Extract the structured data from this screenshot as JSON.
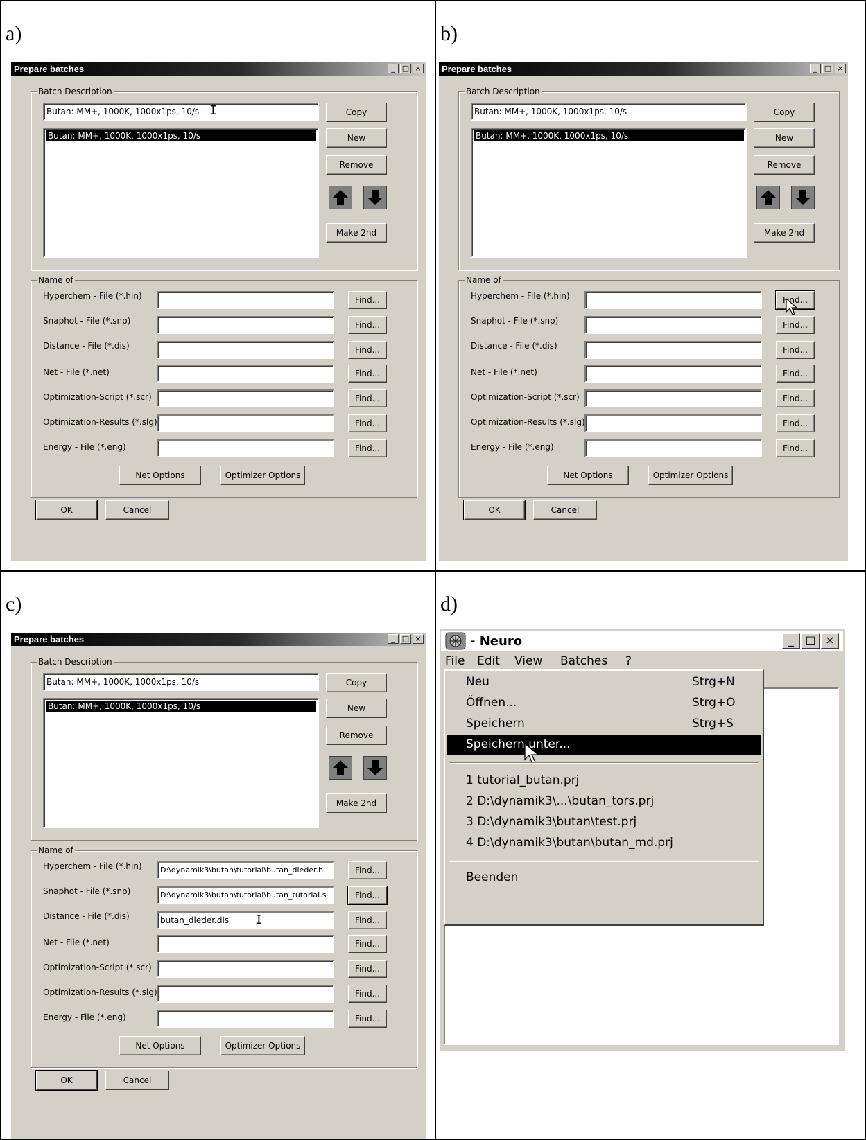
{
  "panels": {
    "a": {
      "label": "a)",
      "dialog": {
        "title": "Prepare batches",
        "batch_group": "Batch Description",
        "description_value": "Butan: MM+, 1000K, 1000x1ps, 10/s",
        "list_selected": "Butan: MM+, 1000K, 1000x1ps, 10/s",
        "buttons": {
          "copy": "Copy",
          "new": "New",
          "remove": "Remove",
          "make2nd": "Make 2nd"
        },
        "name_group": "Name of",
        "files": [
          {
            "label": "Hyperchem - File (*.hin)",
            "value": "",
            "find": "Find..."
          },
          {
            "label": "Snaphot - File (*.snp)",
            "value": "",
            "find": "Find..."
          },
          {
            "label": "Distance - File (*.dis)",
            "value": "",
            "find": "Find..."
          },
          {
            "label": "Net - File (*.net)",
            "value": "",
            "find": "Find..."
          },
          {
            "label": "Optimization-Script (*.scr)",
            "value": "",
            "find": "Find..."
          },
          {
            "label": "Optimization-Results (*.slg)",
            "value": "",
            "find": "Find..."
          },
          {
            "label": "Energy - File (*.eng)",
            "value": "",
            "find": "Find..."
          }
        ],
        "net_options": "Net Options",
        "optimizer_options": "Optimizer Options",
        "ok": "OK",
        "cancel": "Cancel"
      }
    },
    "b": {
      "label": "b)",
      "dialog": {
        "title": "Prepare batches",
        "batch_group": "Batch Description",
        "description_value": "Butan: MM+, 1000K, 1000x1ps, 10/s",
        "list_selected": "Butan: MM+, 1000K, 1000x1ps, 10/s",
        "buttons": {
          "copy": "Copy",
          "new": "New",
          "remove": "Remove",
          "make2nd": "Make 2nd"
        },
        "name_group": "Name of",
        "files": [
          {
            "label": "Hyperchem - File (*.hin)",
            "value": "",
            "find": "Find..."
          },
          {
            "label": "Snaphot - File (*.snp)",
            "value": "",
            "find": "Find..."
          },
          {
            "label": "Distance - File (*.dis)",
            "value": "",
            "find": "Find..."
          },
          {
            "label": "Net - File (*.net)",
            "value": "",
            "find": "Find..."
          },
          {
            "label": "Optimization-Script (*.scr)",
            "value": "",
            "find": "Find..."
          },
          {
            "label": "Optimization-Results (*.slg)",
            "value": "",
            "find": "Find..."
          },
          {
            "label": "Energy - File (*.eng)",
            "value": "",
            "find": "Find..."
          }
        ],
        "net_options": "Net Options",
        "optimizer_options": "Optimizer Options",
        "ok": "OK",
        "cancel": "Cancel"
      }
    },
    "c": {
      "label": "c)",
      "dialog": {
        "title": "Prepare batches",
        "batch_group": "Batch Description",
        "description_value": "Butan: MM+, 1000K, 1000x1ps, 10/s",
        "list_selected": "Butan: MM+, 1000K, 1000x1ps, 10/s",
        "buttons": {
          "copy": "Copy",
          "new": "New",
          "remove": "Remove",
          "make2nd": "Make 2nd"
        },
        "name_group": "Name of",
        "files": [
          {
            "label": "Hyperchem - File (*.hin)",
            "value": "D:\\dynamik3\\butan\\tutorial\\butan_dieder.h",
            "find": "Find..."
          },
          {
            "label": "Snaphot - File (*.snp)",
            "value": "D:\\dynamik3\\butan\\tutorial\\butan_tutorial.s",
            "find": "Find..."
          },
          {
            "label": "Distance - File (*.dis)",
            "value": "butan_dieder.dis",
            "find": "Find..."
          },
          {
            "label": "Net - File (*.net)",
            "value": "",
            "find": "Find..."
          },
          {
            "label": "Optimization-Script (*.scr)",
            "value": "",
            "find": "Find..."
          },
          {
            "label": "Optimization-Results (*.slg)",
            "value": "",
            "find": "Find..."
          },
          {
            "label": "Energy - File (*.eng)",
            "value": "",
            "find": "Find..."
          }
        ],
        "net_options": "Net Options",
        "optimizer_options": "Optimizer Options",
        "ok": "OK",
        "cancel": "Cancel"
      }
    },
    "d": {
      "label": "d)",
      "window": {
        "title": "- Neuro",
        "menus": [
          "File",
          "Edit",
          "View",
          "Batches",
          "?"
        ],
        "file_menu": {
          "items": [
            {
              "label": "Neu",
              "shortcut": "Strg+N"
            },
            {
              "label": "Öffnen...",
              "shortcut": "Strg+O"
            },
            {
              "label": "Speichern",
              "shortcut": "Strg+S"
            },
            {
              "label": "Speichern unter...",
              "shortcut": ""
            }
          ],
          "recent": [
            "1 tutorial_butan.prj",
            "2 D:\\dynamik3\\...\\butan_tors.prj",
            "3 D:\\dynamik3\\butan\\test.prj",
            "4 D:\\dynamik3\\butan\\butan_md.prj"
          ],
          "exit": "Beenden"
        }
      }
    }
  }
}
